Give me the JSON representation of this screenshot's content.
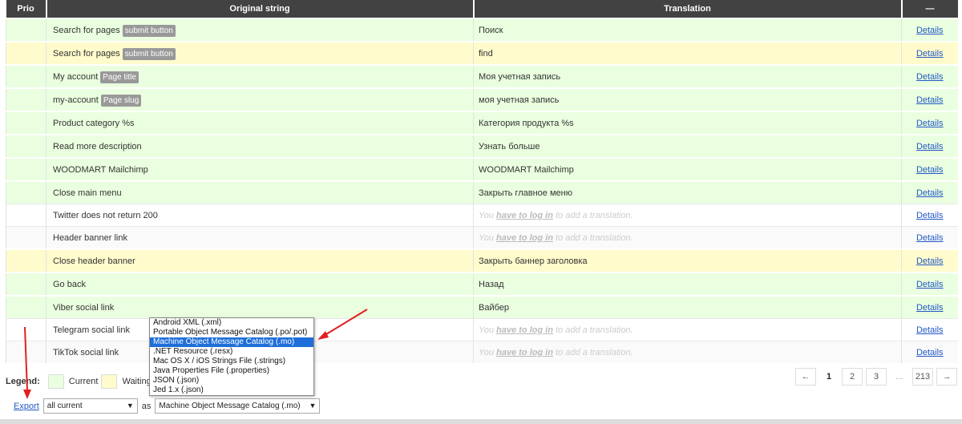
{
  "header": {
    "prio": "Prio",
    "original": "Original string",
    "translation": "Translation",
    "collapse": "—"
  },
  "rows": [
    {
      "status": "current",
      "original": "Search for pages",
      "context": "submit button",
      "translation": "Поиск",
      "details": "Details"
    },
    {
      "status": "waiting",
      "original": "Search for pages",
      "context": "submit button",
      "translation": "find",
      "details": "Details"
    },
    {
      "status": "current",
      "original": "My account",
      "context": "Page title",
      "translation": "Моя учетная запись",
      "details": "Details"
    },
    {
      "status": "current",
      "original": "my-account",
      "context": "Page slug",
      "translation": "моя учетная запись",
      "details": "Details"
    },
    {
      "status": "current",
      "original": "Product category %s",
      "context": "",
      "translation": "Категория продукта %s",
      "details": "Details"
    },
    {
      "status": "current",
      "original": "Read more description",
      "context": "",
      "translation": "Узнать больше",
      "details": "Details"
    },
    {
      "status": "current",
      "original": "WOODMART Mailchimp",
      "context": "",
      "translation": "WOODMART Mailchimp",
      "details": "Details"
    },
    {
      "status": "current",
      "original": "Close main menu",
      "context": "",
      "translation": "Закрыть главное меню",
      "details": "Details"
    },
    {
      "status": "untranslated",
      "original": "Twitter does not return 200",
      "context": "",
      "translation": "",
      "details": "Details"
    },
    {
      "status": "untranslated",
      "original": "Header banner link",
      "context": "",
      "translation": "",
      "details": "Details"
    },
    {
      "status": "waiting",
      "original": "Close header banner",
      "context": "",
      "translation": "Закрыть баннер заголовка",
      "details": "Details"
    },
    {
      "status": "current",
      "original": "Go back",
      "context": "",
      "translation": "Назад",
      "details": "Details"
    },
    {
      "status": "current",
      "original": "Viber social link",
      "context": "",
      "translation": "Вайбер",
      "details": "Details"
    },
    {
      "status": "untranslated",
      "original": "Telegram social link",
      "context": "",
      "translation": "",
      "details": "Details"
    },
    {
      "status": "untranslated",
      "original": "TikTok social link",
      "context": "",
      "translation": "",
      "details": "Details"
    }
  ],
  "placeholder": {
    "pre": "You ",
    "link": "have to log in",
    "post": " to add a translation."
  },
  "legend": {
    "label": "Legend:",
    "current": "Current",
    "waiting": "Waiting"
  },
  "pager": {
    "prev": "←",
    "pages": [
      "1",
      "2",
      "3"
    ],
    "dots": "...",
    "last": "213",
    "next": "→",
    "current": "1"
  },
  "export": {
    "link": "Export",
    "filter_value": "all current",
    "as_label": "as",
    "format_value": "Machine Object Message Catalog (.mo)",
    "format_options": [
      "Android XML (.xml)",
      "Portable Object Message Catalog (.po/.pot)",
      "Machine Object Message Catalog (.mo)",
      ".NET Resource (.resx)",
      "Mac OS X / iOS Strings File (.strings)",
      "Java Properties File (.properties)",
      "JSON (.json)",
      "Jed 1.x (.json)"
    ],
    "highlighted_index": 2
  },
  "colors": {
    "current": "#eaffdf",
    "waiting": "#fffbcc",
    "header": "#424242",
    "link": "#2258c7",
    "arrow": "#e02020",
    "highlight": "#1e6fd9"
  }
}
